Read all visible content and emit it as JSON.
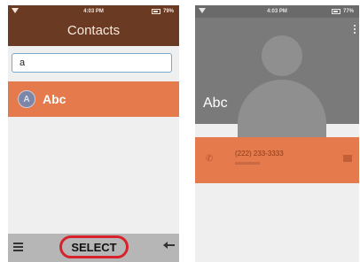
{
  "left_screen": {
    "status": {
      "time": "4:03 PM",
      "battery": "79%"
    },
    "title": "Contacts",
    "search": {
      "value": "a"
    },
    "contacts": [
      {
        "initial": "A",
        "name": "Abc"
      }
    ],
    "bottom": {
      "select_label": "SELECT"
    },
    "colors": {
      "header": "#6b3a22",
      "accent": "#e57a4c",
      "highlight_ring": "#d8222b"
    }
  },
  "right_screen": {
    "status": {
      "time": "4:03 PM",
      "battery": "77%"
    },
    "contact_name": "Abc",
    "phone": {
      "number": "(222) 233-3333"
    },
    "colors": {
      "header": "#7a7a7a",
      "accent": "#e57a4c"
    }
  }
}
